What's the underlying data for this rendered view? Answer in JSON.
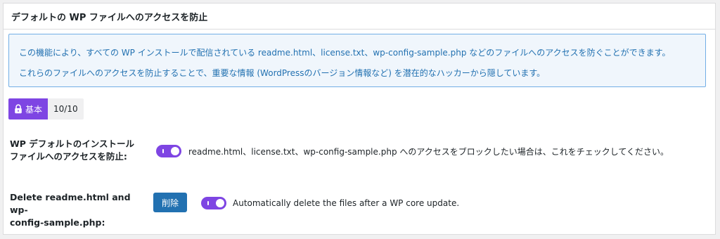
{
  "panel": {
    "title": "デフォルトの WP ファイルへのアクセスを防止"
  },
  "notice": {
    "line1": "この機能により、すべての WP インストールで配信されている readme.html、license.txt、wp-config-sample.php などのファイルへのアクセスを防ぐことができます。",
    "line2": "これらのファイルへのアクセスを防止することで、重要な情報 (WordPressのバージョン情報など) を潜在的なハッカーから隠しています。"
  },
  "badge": {
    "icon": "lock-icon",
    "label": "基本",
    "score": "10/10"
  },
  "settings": {
    "block_access": {
      "label_line1": "WP デフォルトのインストール",
      "label_line2": "ファイルへのアクセスを防止:",
      "enabled": true,
      "description": "readme.html、license.txt、wp-config-sample.php へのアクセスをブロックしたい場合は、これをチェックしてください。"
    },
    "delete_files": {
      "label_line1": "Delete readme.html and wp-",
      "label_line2": "config-sample.php:",
      "button_label": "削除",
      "enabled": true,
      "description": "Automatically delete the files after a WP core update."
    }
  },
  "colors": {
    "accent": "#7e45e3",
    "link": "#2271b1",
    "notice_bg": "#f0f6fc",
    "notice_border": "#72aee6",
    "button": "#2271b1"
  }
}
